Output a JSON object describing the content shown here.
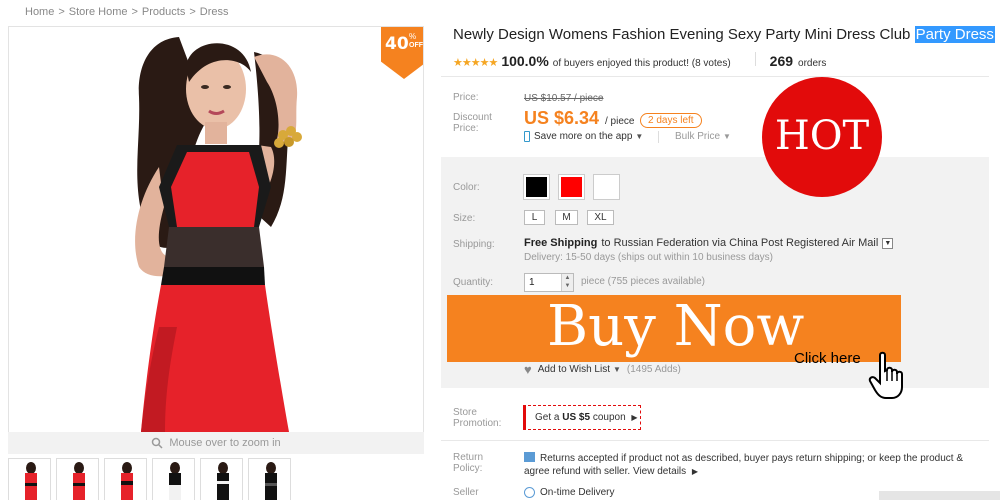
{
  "breadcrumb": [
    "Home",
    "Store Home",
    "Products",
    "Dress"
  ],
  "breadcrumb_sep": ">",
  "badge": {
    "percent": "40",
    "pct_sign": "%",
    "off": "OFF"
  },
  "product": {
    "title": "Newly Design Womens Fashion Evening Sexy Party Mini Dress Club ",
    "title_highlight": "Party Dress",
    "rating_stars": "★★★★★",
    "rating_pct": "100.0%",
    "rating_text": "of buyers enjoyed this product! (8 votes)",
    "orders_count": "269",
    "orders_label": "orders"
  },
  "price": {
    "label": "Price:",
    "old": "US $10.57 / piece",
    "discount_label": "Discount Price:",
    "current": "US $6.34",
    "per": "/ piece",
    "days_left": "2 days left",
    "save_app": "Save more on the app",
    "bulk": "Bulk Price"
  },
  "hot_label": "HOT",
  "options": {
    "color_label": "Color:",
    "colors": [
      "#000000",
      "#ff0000",
      "#ffffff"
    ],
    "size_label": "Size:",
    "sizes": [
      "L",
      "M",
      "XL"
    ],
    "shipping_label": "Shipping:",
    "shipping_bold": "Free Shipping",
    "shipping_rest": "to  Russian Federation via China Post Registered Air Mail",
    "delivery": "Delivery: 15-50 days (ships out within 10 business days)",
    "quantity_label": "Quantity:",
    "quantity": "1",
    "quantity_avail": "piece (755 pieces available)"
  },
  "buy_now": "Buy  Now",
  "click_here": "Click here",
  "wishlist": {
    "label": "Add to Wish List",
    "adds": "(1495 Adds)"
  },
  "store_promotion_label": "Store Promotion:",
  "coupon": {
    "prefix": "Get a ",
    "amount": "US $5",
    "suffix": " coupon"
  },
  "return_policy_label": "Return Policy:",
  "return_text": "Returns accepted if product not as described, buyer pays return shipping; or keep the product & agree refund with seller.",
  "view_details": "View details",
  "seller_label": "Seller",
  "on_time": "On-time Delivery",
  "zoom_text": "Mouse over to zoom in",
  "colors": {
    "accent": "#f5821f",
    "hot": "#e20b0b",
    "highlight": "#3399ff"
  }
}
